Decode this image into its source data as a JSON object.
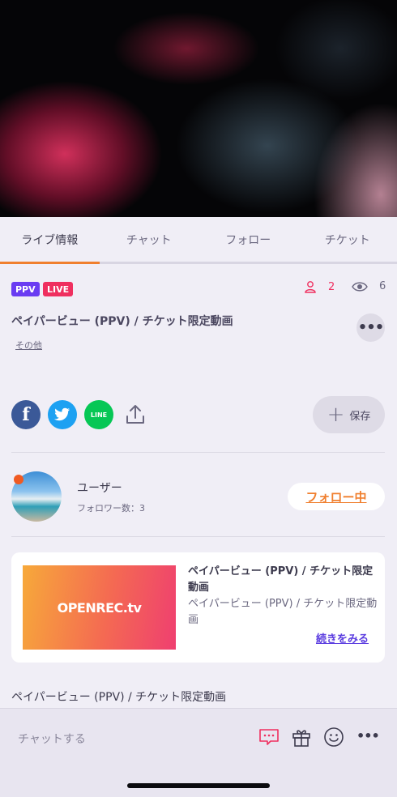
{
  "tabs": [
    {
      "label": "ライブ情報",
      "active": true
    },
    {
      "label": "チャット",
      "active": false
    },
    {
      "label": "フォロー",
      "active": false
    },
    {
      "label": "チケット",
      "active": false
    }
  ],
  "badges": {
    "ppv": "PPV",
    "live": "LIVE"
  },
  "stats": {
    "viewers": "2",
    "views": "6"
  },
  "stream": {
    "title": "ペイパービュー (PPV) / チケット限定動画",
    "other_link": "その他",
    "more_icon": "•••"
  },
  "share": {
    "facebook": "f",
    "line": "LINE",
    "save_label": "保存",
    "save_icon": "+"
  },
  "user": {
    "name": "ユーザー",
    "followers": "フォロワー数：3",
    "follow_label": "フォロー中"
  },
  "card": {
    "thumb_logo": "OPENREC.tv",
    "title": "ペイパービュー (PPV) / チケット限定動画",
    "desc": "ペイパービュー (PPV) / チケット限定動画",
    "read_more": "続きをみる"
  },
  "description": "ペイパービュー (PPV) / チケット限定動画",
  "chat": {
    "placeholder": "チャットする",
    "more_icon": "•••"
  },
  "colors": {
    "accent": "#f07f2e",
    "live": "#ef2f5f",
    "ppv": "#6a3cf2",
    "link": "#5b3de0"
  }
}
